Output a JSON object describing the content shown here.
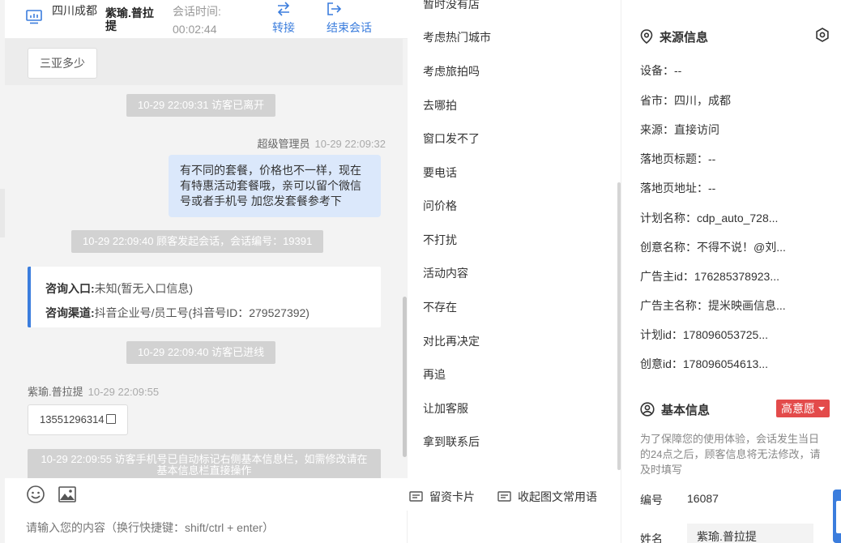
{
  "header": {
    "location": "四川成都",
    "visitor_name": "紫瑜.普拉提",
    "session_time_label": "会话时间:",
    "session_time": "00:02:44",
    "transfer_label": "转接",
    "end_label": "结束会话"
  },
  "chat": {
    "quick_chip": "三亚多少",
    "sys_left": "10-29 22:09:31 访客已离开",
    "agent_name": "超级管理员",
    "agent_time": "10-29 22:09:32",
    "agent_message": "有不同的套餐，价格也不一样，现在有特惠活动套餐哦，亲可以留个微信号或者手机号 加您发套餐参考下",
    "sys_session": "10-29 22:09:40 顾客发起会话，会话编号：19391",
    "card_entry_label": "咨询入口:",
    "card_entry_value": "未知(暂无入口信息)",
    "card_channel_label": "咨询渠道:",
    "card_channel_value": "抖音企业号/员工号(抖音号ID：279527392)",
    "sys_enter": "10-29 22:09:40 访客已进线",
    "visitor_name": "紫瑜.普拉提",
    "visitor_time": "10-29 22:09:55",
    "visitor_message": "13551296314",
    "sys_phone": "10-29 22:09:55 访客手机号已自动标记右侧基本信息栏，如需修改请在基本信息栏直接操作",
    "input_placeholder": "请输入您的内容（换行快捷键：shift/ctrl + enter）"
  },
  "replies": {
    "items": [
      "暂时没有店",
      "考虑热门城市",
      "考虑旅拍吗",
      "去哪拍",
      "窗口发不了",
      "要电话",
      "问价格",
      "不打扰",
      "活动内容",
      "不存在",
      "对比再决定",
      "再追",
      "让加客服",
      "拿到联系后"
    ],
    "lead_card_label": "留资卡片",
    "collapse_label": "收起图文常用语"
  },
  "source_info": {
    "title": "来源信息",
    "rows": [
      "设备：--",
      "省市：四川，成都",
      "来源：直接访问",
      "落地页标题：--",
      "落地页地址：--",
      "计划名称：cdp_auto_728...",
      "创意名称：不得不说！@刘...",
      "广告主id：176285378923...",
      "广告主名称：提米映画信息...",
      "计划id：178096053725...",
      "创意id：178096054613..."
    ]
  },
  "basic_info": {
    "title": "基本信息",
    "intent_badge": "高意愿",
    "notice": "为了保障您的使用体验，会话发生当日的24点之后，顾客信息将无法修改，请及时填写",
    "id_label": "编号",
    "id_value": "16087",
    "name_label": "姓名",
    "name_value": "紫瑜.普拉提"
  },
  "colors": {
    "accent": "#3b7ddd",
    "badge": "#e34b4b",
    "bubble_agent": "#dbe8fb",
    "system_msg": "#d2d2d2"
  }
}
